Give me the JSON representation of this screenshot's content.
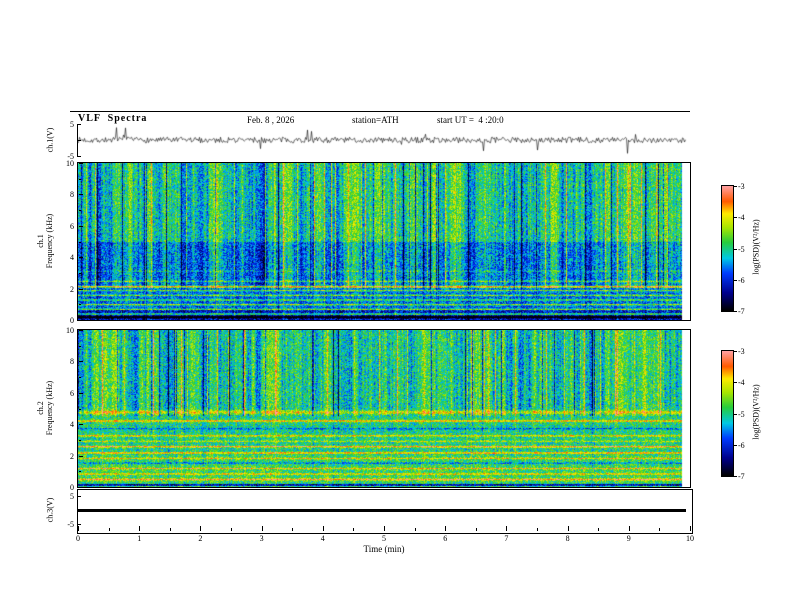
{
  "header": {
    "title": "VLF  Spectra",
    "date": "Feb. 8 , 2026",
    "station": "station=ATH",
    "start_ut": "start UT =  4 :20:0"
  },
  "xaxis": {
    "label": "Time (min)",
    "ticks": [
      "0",
      "1",
      "2",
      "3",
      "4",
      "5",
      "6",
      "7",
      "8",
      "9",
      "10"
    ],
    "range_min": [
      0,
      10
    ],
    "minor_step_min": 0.5
  },
  "colors": {
    "background": "#ffffff",
    "axis": "#000000",
    "trace": "#000000",
    "colormap": [
      [
        0.0,
        "#000000"
      ],
      [
        0.14,
        "#00008c"
      ],
      [
        0.3,
        "#003cff"
      ],
      [
        0.42,
        "#00c8e6"
      ],
      [
        0.55,
        "#28cd3c"
      ],
      [
        0.67,
        "#aae600"
      ],
      [
        0.78,
        "#ffeb00"
      ],
      [
        0.88,
        "#ff5a00"
      ],
      [
        1.0,
        "#ffa0a0"
      ]
    ]
  },
  "chart_data": [
    {
      "id": "ch1_waveform",
      "type": "line",
      "panel": "waveform-top",
      "ylabel": "ch.1(V)",
      "ylim_v": [
        -5,
        5
      ],
      "yticks": [
        "5",
        "-5"
      ],
      "xlim_min": [
        0,
        10
      ],
      "description": "Broadband VLF noise waveform fluctuating about 0 V (roughly ±1 V) with frequent impulsive sferic spikes reaching about ±4.5 V across the full 10 minutes",
      "params": {
        "seed": 7,
        "noise_v": 0.9,
        "spike_prob": 0.032,
        "spike_v": [
          2.0,
          4.5
        ]
      }
    },
    {
      "id": "ch1_spectrogram",
      "type": "heatmap",
      "ylabel_lines": [
        "ch.1",
        "Frequency (kHz)"
      ],
      "ylim_khz": [
        0,
        10
      ],
      "yticks": [
        "10",
        "8",
        "6",
        "4",
        "2",
        "0"
      ],
      "xlim_min": [
        0,
        10
      ],
      "colorbar": {
        "label": "log(PSD)(V²/Hz)",
        "ticks": [
          "-3",
          "-4",
          "-5",
          "-6",
          "-7"
        ],
        "range_log10": [
          -7,
          -3
        ]
      },
      "description": "Spectrogram of ch.1: green/cyan background densely striated by vertical sferic impulses (yellow bright columns, dark blue quiet columns), bluer quiet band 2-5 kHz, nearly black band at the lowest frequencies and bright horizontal interference/hum lines below ~2.5 kHz including a red line near 2.1 kHz",
      "texture": {
        "seed": 101,
        "noise": 0.15,
        "stripe_amp": 0.26,
        "stripe_cutoff_khz": 2,
        "stripe_low_weight": 0.3,
        "bands": [
          [
            5,
            10.01,
            0.5
          ],
          [
            2,
            5,
            0.38
          ],
          [
            0.6,
            2,
            0.34
          ],
          [
            -0.01,
            0.6,
            0.22
          ]
        ],
        "lines": [
          [
            0.15,
            0.08,
            -0.35
          ],
          [
            0.35,
            0.05,
            0.4
          ],
          [
            0.65,
            0.05,
            0.3
          ],
          [
            0.95,
            0.05,
            0.32
          ],
          [
            1.25,
            0.05,
            0.28
          ],
          [
            1.55,
            0.05,
            0.3
          ],
          [
            1.85,
            0.05,
            0.28
          ],
          [
            2.1,
            0.06,
            0.5
          ],
          [
            2.45,
            0.05,
            0.25
          ],
          [
            3.1,
            0.05,
            0.12
          ]
        ]
      }
    },
    {
      "id": "ch2_spectrogram",
      "type": "heatmap",
      "ylabel_lines": [
        "ch.2",
        "Frequency (kHz)"
      ],
      "ylim_khz": [
        0,
        10
      ],
      "yticks": [
        "10",
        "8",
        "6",
        "4",
        "2",
        "0"
      ],
      "xlim_min": [
        0,
        10
      ],
      "colorbar": {
        "label": "log(PSD)(V²/Hz)",
        "ticks": [
          "-3",
          "-4",
          "-5",
          "-6",
          "-7"
        ],
        "range_log10": [
          -7,
          -3
        ]
      },
      "description": "Spectrogram of ch.2: overall greener than ch.1, vertical sferic striations mostly above ~4.5 kHz, strong horizontal interference lines between 0 and 5 kHz (yellow band near 4.7 kHz, red/orange lines near 2.1-2.6 and 4.2 kHz), bright green low band below 2 kHz with a dark line at the very bottom",
      "texture": {
        "seed": 202,
        "noise": 0.15,
        "stripe_amp": 0.24,
        "stripe_cutoff_khz": 4.5,
        "stripe_low_weight": 0.2,
        "bands": [
          [
            5,
            10.01,
            0.5
          ],
          [
            2,
            5,
            0.5
          ],
          [
            -0.01,
            2,
            0.54
          ]
        ],
        "lines": [
          [
            4.75,
            0.12,
            0.26
          ],
          [
            4.2,
            0.06,
            0.34
          ],
          [
            3.7,
            0.05,
            -0.18
          ],
          [
            3.25,
            0.05,
            0.3
          ],
          [
            2.9,
            0.05,
            0.2
          ],
          [
            2.55,
            0.05,
            0.42
          ],
          [
            2.15,
            0.05,
            0.4
          ],
          [
            1.8,
            0.05,
            0.26
          ],
          [
            1.5,
            0.05,
            -0.2
          ],
          [
            1.15,
            0.05,
            0.3
          ],
          [
            0.8,
            0.05,
            0.28
          ],
          [
            0.45,
            0.06,
            0.38
          ],
          [
            0.1,
            0.06,
            -0.45
          ]
        ]
      }
    },
    {
      "id": "ch3_waveform",
      "type": "line",
      "panel": "waveform-bottom",
      "ylabel": "ch.3(V)",
      "ylim_v": [
        -5,
        5
      ],
      "yticks": [
        "5",
        "-5"
      ],
      "xlim_min": [
        0,
        10
      ],
      "constant_value_v": 0,
      "description": "Flat thick black trace at 0 V for the whole interval (channel inactive)"
    }
  ]
}
